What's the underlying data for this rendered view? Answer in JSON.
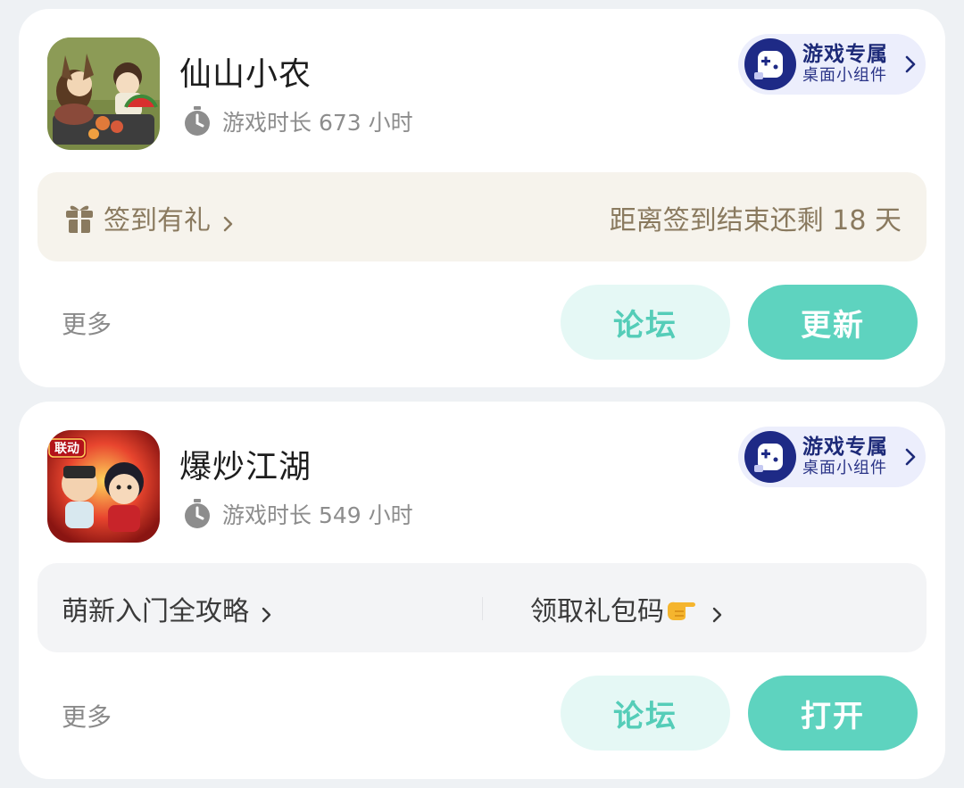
{
  "games": [
    {
      "title": "仙山小农",
      "playtime": "游戏时长 673 小时",
      "widget_badge": {
        "line1": "游戏专属",
        "line2": "桌面小组件"
      },
      "checkin": {
        "label": "签到有礼",
        "remaining": "距离签到结束还剩 18 天"
      },
      "more_label": "更多",
      "forum_button": "论坛",
      "action_button": "更新"
    },
    {
      "title": "爆炒江湖",
      "playtime": "游戏时长 549 小时",
      "icon_tag": "联动",
      "widget_badge": {
        "line1": "游戏专属",
        "line2": "桌面小组件"
      },
      "links": {
        "left": "萌新入门全攻略",
        "right": "领取礼包码"
      },
      "more_label": "更多",
      "forum_button": "论坛",
      "action_button": "打开"
    }
  ],
  "colors": {
    "accent": "#5ed3bf",
    "accent_light": "#e5f8f5",
    "badge_bg": "#eceefc",
    "badge_text": "#1d2a78",
    "checkin_bg": "#f6f3ec",
    "checkin_text": "#8a7a5f"
  },
  "icons": [
    "timer-icon",
    "gamepad-icon",
    "chevron-right-icon",
    "gift-icon",
    "pointing-hand-emoji"
  ]
}
